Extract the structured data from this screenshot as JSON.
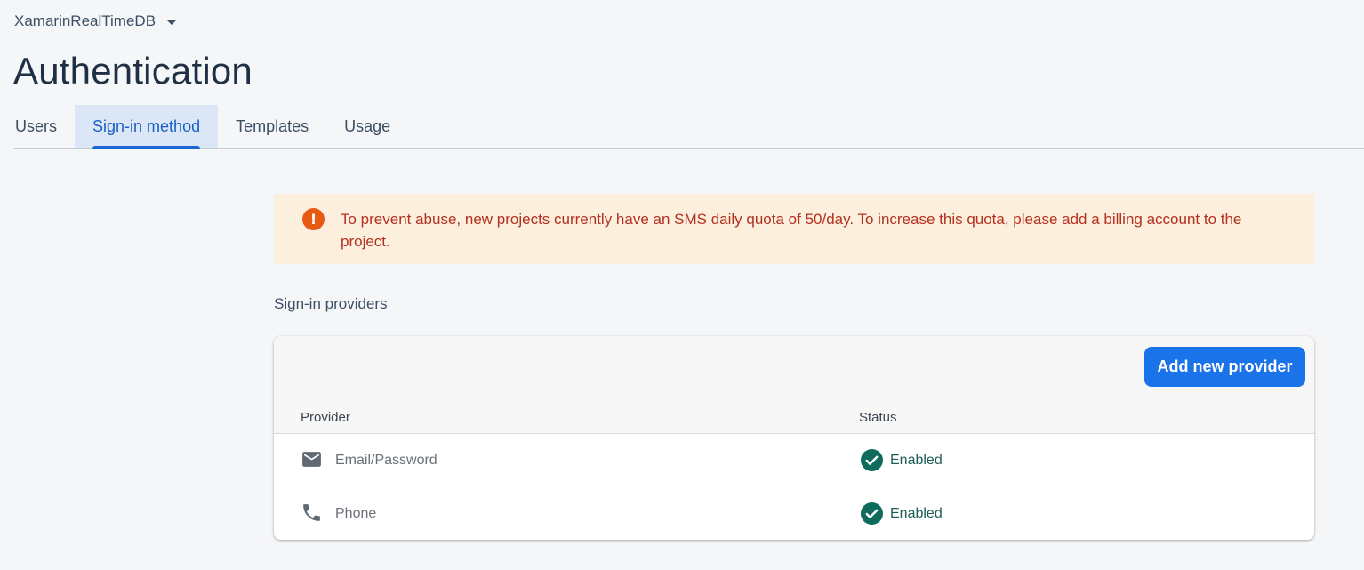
{
  "header": {
    "project_name": "XamarinRealTimeDB",
    "title": "Authentication"
  },
  "tabs": [
    {
      "label": "Users",
      "active": false
    },
    {
      "label": "Sign-in method",
      "active": true
    },
    {
      "label": "Templates",
      "active": false
    },
    {
      "label": "Usage",
      "active": false
    }
  ],
  "alert": {
    "icon": "error-exclamation-icon",
    "text": "To prevent abuse, new projects currently have an SMS daily quota of 50/day. To increase this quota, please add a billing account to the project."
  },
  "providers_section": {
    "title": "Sign-in providers",
    "add_button_label": "Add new provider",
    "columns": {
      "provider": "Provider",
      "status": "Status"
    },
    "rows": [
      {
        "icon": "email-icon",
        "provider": "Email/Password",
        "status": "Enabled"
      },
      {
        "icon": "phone-icon",
        "provider": "Phone",
        "status": "Enabled"
      }
    ]
  },
  "colors": {
    "accent": "#1a73e8",
    "enabled": "#0f6b5c",
    "warning_bg": "#fdefde",
    "warning_text": "#b3311f"
  }
}
